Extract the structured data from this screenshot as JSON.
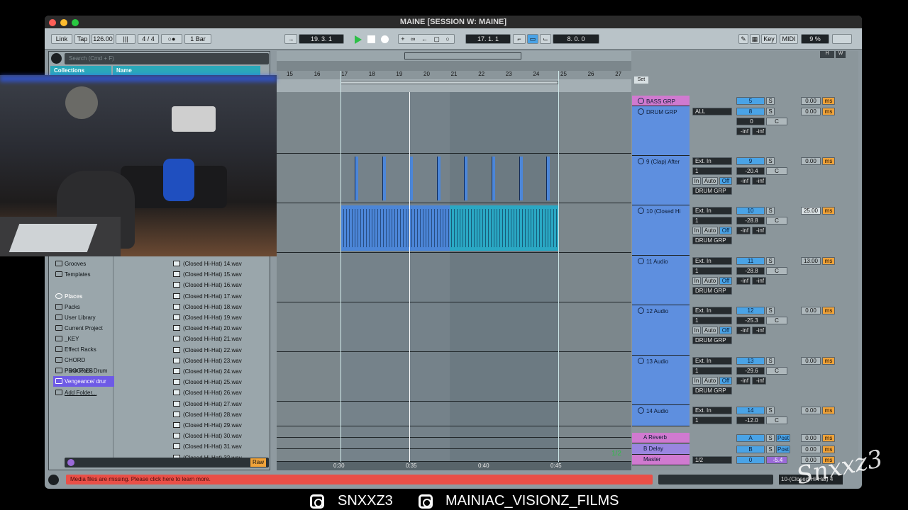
{
  "window": {
    "title": "MAINE  [SESSION W: MAINE]"
  },
  "control_bar": {
    "link": "Link",
    "tap": "Tap",
    "tempo": "126.00",
    "signature": "4 / 4",
    "quantize": "1 Bar",
    "position": "19.  3.  1",
    "loop_start": "17.  1.  1",
    "loop_length": "8.  0.  0",
    "key": "Key",
    "midi": "MIDI",
    "cpu": "9 %"
  },
  "browser": {
    "search_placeholder": "Search (Cmd + F)",
    "collections_header": "Collections",
    "name_header": "Name",
    "categories": [
      "Grooves",
      "Templates"
    ],
    "places_header": "Places",
    "places": [
      "Packs",
      "User Library",
      "Current Project",
      "_KEY",
      "Effect Racks",
      "CHORD PROGRES",
      "Punk Rock Drum",
      "Vengeance/ drur",
      "Add Folder..."
    ],
    "files": [
      "(Closed Hi-Hat) 14.wav",
      "(Closed Hi-Hat) 15.wav",
      "(Closed Hi-Hat) 16.wav",
      "(Closed Hi-Hat) 17.wav",
      "(Closed Hi-Hat) 18.wav",
      "(Closed Hi-Hat) 19.wav",
      "(Closed Hi-Hat) 20.wav",
      "(Closed Hi-Hat) 21.wav",
      "(Closed Hi-Hat) 22.wav",
      "(Closed Hi-Hat) 23.wav",
      "(Closed Hi-Hat) 24.wav",
      "(Closed Hi-Hat) 25.wav",
      "(Closed Hi-Hat) 26.wav",
      "(Closed Hi-Hat) 27.wav",
      "(Closed Hi-Hat) 28.wav",
      "(Closed Hi-Hat) 29.wav",
      "(Closed Hi-Hat) 30.wav",
      "(Closed Hi-Hat) 31.wav",
      "(Closed Hi-Hat) 32.wav"
    ],
    "raw": "Raw"
  },
  "ruler": {
    "bars": [
      "15",
      "16",
      "17",
      "18",
      "19",
      "20",
      "21",
      "22",
      "23",
      "24",
      "25",
      "26",
      "27"
    ],
    "set": "Set"
  },
  "time_ruler": [
    "0:30",
    "0:35",
    "0:40",
    "0:45"
  ],
  "page_indicator": "1/2",
  "tracks": [
    {
      "name": "BASS GRP",
      "num": "5",
      "vol": "0.00",
      "color": "#e07ad6"
    },
    {
      "name": "DRUM GRP",
      "input": "ALL",
      "num": "8",
      "pan_a": "0",
      "pan_b": "C",
      "meter_a": "-inf",
      "meter_b": "-inf",
      "vol": "0.00",
      "color": "#5e8fdf"
    },
    {
      "name": "9 (Clap) After",
      "input": "Ext. In",
      "channel": "1",
      "num": "9",
      "db": "-20.4",
      "pan": "C",
      "route": "DRUM GRP",
      "meter_a": "-inf",
      "meter_b": "-inf",
      "vol": "0.00"
    },
    {
      "name": "10 (Closed Hi",
      "input": "Ext. In",
      "channel": "1",
      "num": "10",
      "db": "-28.8",
      "pan": "C",
      "route": "DRUM GRP",
      "meter_a": "-inf",
      "meter_b": "-inf",
      "vol": "25.00"
    },
    {
      "name": "11 Audio",
      "input": "Ext. In",
      "channel": "1",
      "num": "11",
      "db": "-28.8",
      "pan": "C",
      "route": "DRUM GRP",
      "meter_a": "-inf",
      "meter_b": "-inf",
      "vol": "13.00"
    },
    {
      "name": "12 Audio",
      "input": "Ext. In",
      "channel": "1",
      "num": "12",
      "db": "-25.3",
      "pan": "C",
      "route": "DRUM GRP",
      "meter_a": "-inf",
      "meter_b": "-inf",
      "vol": "0.00"
    },
    {
      "name": "13 Audio",
      "input": "Ext. In",
      "channel": "1",
      "num": "13",
      "db": "-29.6",
      "pan": "C",
      "route": "DRUM GRP",
      "meter_a": "-inf",
      "meter_b": "-inf",
      "vol": "0.00"
    },
    {
      "name": "14 Audio",
      "input": "Ext. In",
      "channel": "1",
      "num": "14",
      "db": "-12.0",
      "pan": "C",
      "vol": "0.00"
    }
  ],
  "return_tracks": [
    {
      "name": "A Reverb",
      "letter": "A",
      "post": "Post",
      "vol": "0.00"
    },
    {
      "name": "B Delay",
      "letter": "B",
      "post": "Post",
      "vol": "0.00"
    },
    {
      "name": "Master",
      "route": "1/2",
      "num": "0",
      "db": "-5.4",
      "vol": "0.00"
    }
  ],
  "mixer_labels": {
    "in": "In",
    "auto": "Auto",
    "off": "Off",
    "s": "S",
    "ms": "ms"
  },
  "status": {
    "message": "Media files are missing. Please click here to learn more.",
    "selected": "10-(Closed Hi-Hat) 4"
  },
  "overlay": {
    "instagram1": "SNXXZ3",
    "instagram2": "MAINIAC_VISIONZ_FILMS",
    "watermark": "Snxxz3"
  },
  "colors": {
    "accent": "#2aa8b9",
    "track_blue": "#5e8fdf",
    "orange": "#f0a33a",
    "error": "#e94f47"
  }
}
